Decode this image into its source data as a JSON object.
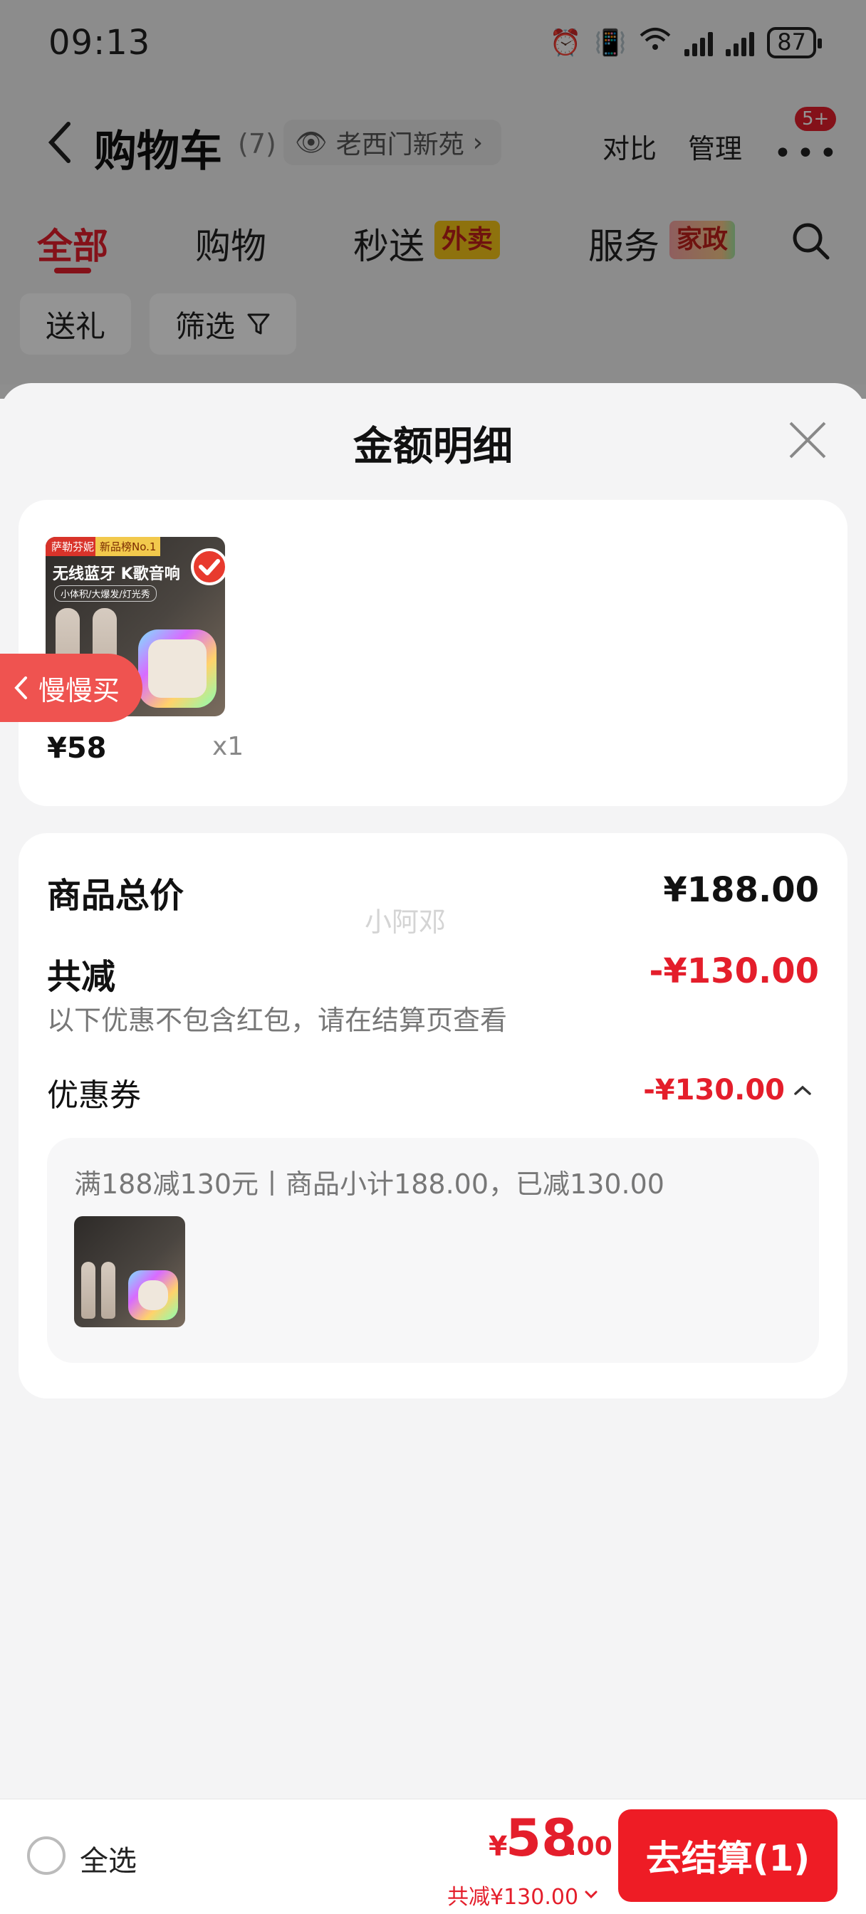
{
  "status_bar": {
    "time": "09:13",
    "network_label": "6",
    "battery": "87"
  },
  "nav": {
    "title": "购物车",
    "count": "(7)",
    "address": "老西门新苑",
    "compare": "对比",
    "manage": "管理",
    "message_badge": "5+"
  },
  "tabs": [
    {
      "label": "全部",
      "active": true
    },
    {
      "label": "购物"
    },
    {
      "label": "秒送",
      "tag": "外卖"
    },
    {
      "label": "服务",
      "tag": "家政"
    }
  ],
  "filters": {
    "gift": "送礼",
    "filter": "筛选"
  },
  "sheet": {
    "title": "金额明细",
    "product": {
      "image_brand": "萨勒芬妮",
      "image_rank": "新品榜No.1",
      "image_headline": "无线蓝牙 K歌音响",
      "image_subline": "小体积/大爆发/灯光秀",
      "price": "¥58",
      "qty": "x1"
    },
    "slow_buy": "慢慢买",
    "watermark": "小阿邓",
    "detail": {
      "total_label": "商品总价",
      "total_value": "¥188.00",
      "discount_label": "共减",
      "discount_value": "-¥130.00",
      "note": "以下优惠不包含红包，请在结算页查看",
      "coupon_label": "优惠券",
      "coupon_value": "-¥130.00",
      "coupon_desc": "满188减130元丨商品小计188.00，已减130.00"
    }
  },
  "bottom": {
    "select_all": "全选",
    "currency": "¥",
    "total_int": "58",
    "total_dec": ".00",
    "saved": "共减¥130.00",
    "checkout": "去结算(1)"
  },
  "colors": {
    "accent": "#e41e2b",
    "sheet_bg": "#f4f4f5",
    "card_bg": "#ffffff"
  }
}
